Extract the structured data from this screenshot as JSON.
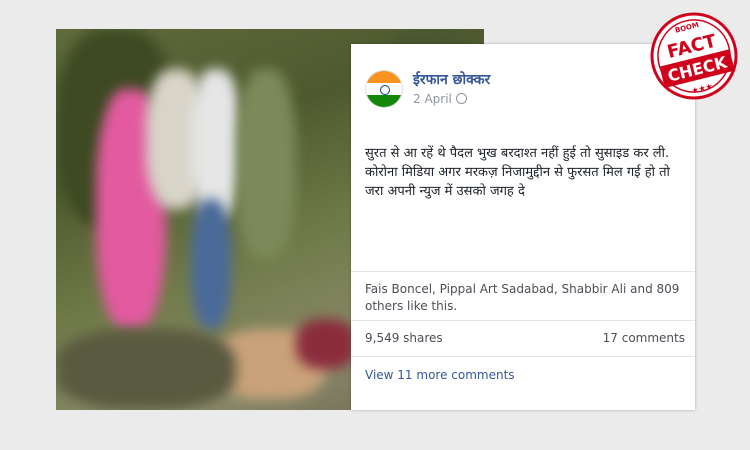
{
  "post": {
    "author": "ईरफान छोक्कर",
    "date": "2 April",
    "privacy_icon": "globe-icon",
    "text_line1": "सुरत से आ रहें थे पैदल भुख बरदाश्त नहीं हुई तो सुसाइड कर ली.",
    "text_line2": "कोरोना मिडिया अगर मरकज़ निजामुद्दीन से फुरसत मिल गई हो तो जरा अपनी न्युज में उसको जगह दे",
    "likes_text": "Fais Boncel, Pippal Art Sadabad, Shabbir Ali and 809 others like this.",
    "shares": "9,549 shares",
    "comments": "17 comments",
    "view_more": "View 11 more comments"
  },
  "stamp": {
    "top_text": "BOOM",
    "line1": "FACT",
    "line2": "CHECK",
    "stars": "★★★"
  },
  "colors": {
    "link": "#365899",
    "stamp_red": "#d0021b",
    "meta_gray": "#90949c"
  }
}
